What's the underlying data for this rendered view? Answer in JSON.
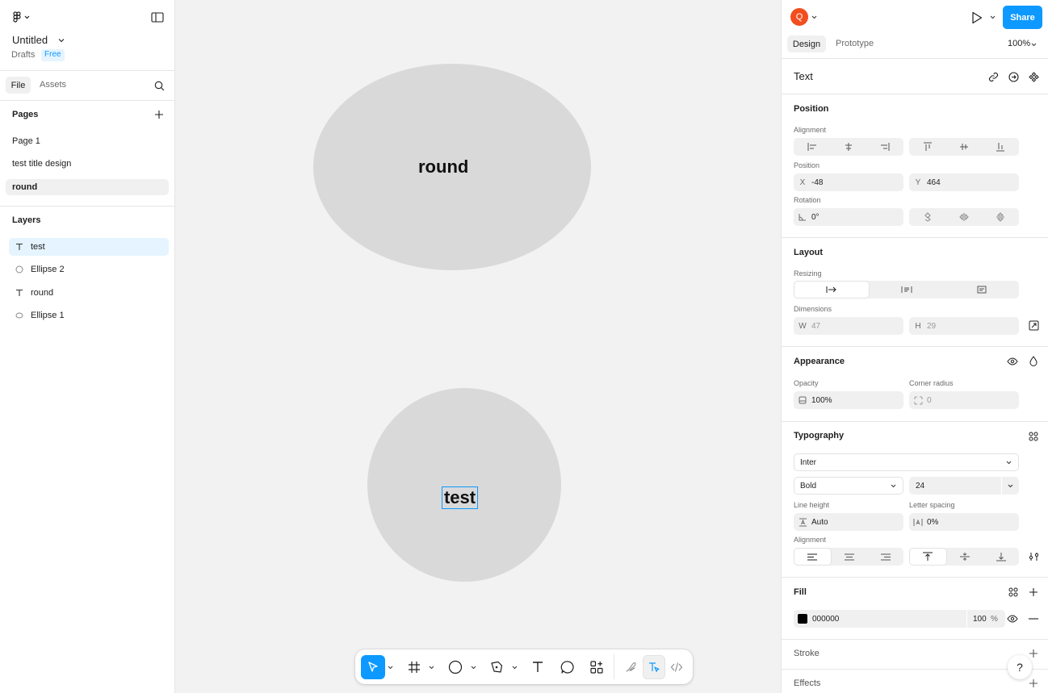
{
  "file": {
    "title": "Untitled",
    "location": "Drafts",
    "plan_badge": "Free"
  },
  "left_tabs": {
    "file": "File",
    "assets": "Assets"
  },
  "pages": {
    "heading": "Pages",
    "items": [
      "Page 1",
      "test  title design",
      "round"
    ],
    "selected": "round"
  },
  "layers": {
    "heading": "Layers",
    "items": [
      {
        "name": "test",
        "icon": "text-icon",
        "selected": true
      },
      {
        "name": "Ellipse 2",
        "icon": "ellipse-icon",
        "selected": false
      },
      {
        "name": "round",
        "icon": "text-icon",
        "selected": false
      },
      {
        "name": "Ellipse 1",
        "icon": "ellipse-icon",
        "selected": false
      }
    ]
  },
  "canvas": {
    "text_round": "round",
    "text_test": "test"
  },
  "header": {
    "avatar_letter": "Q",
    "share": "Share",
    "zoom": "100%",
    "tab_design": "Design",
    "tab_prototype": "Prototype"
  },
  "selection": {
    "type": "Text"
  },
  "position": {
    "title": "Position",
    "alignment_label": "Alignment",
    "position_label": "Position",
    "x_label": "X",
    "x": "-48",
    "y_label": "Y",
    "y": "464",
    "rotation_label": "Rotation",
    "rotation": "0°"
  },
  "layout": {
    "title": "Layout",
    "resizing_label": "Resizing",
    "dimensions_label": "Dimensions",
    "w_label": "W",
    "w": "47",
    "h_label": "H",
    "h": "29"
  },
  "appearance": {
    "title": "Appearance",
    "opacity_label": "Opacity",
    "opacity": "100%",
    "radius_label": "Corner radius",
    "radius": "0"
  },
  "typography": {
    "title": "Typography",
    "font": "Inter",
    "weight": "Bold",
    "size": "24",
    "line_height_label": "Line height",
    "line_height": "Auto",
    "letter_spacing_label": "Letter spacing",
    "letter_spacing": "0%",
    "alignment_label": "Alignment"
  },
  "fill": {
    "title": "Fill",
    "hex": "000000",
    "opacity": "100",
    "percent": "%",
    "swatch_color": "#000000"
  },
  "stroke": {
    "title": "Stroke"
  },
  "effects": {
    "title": "Effects"
  },
  "help": "?",
  "colors": {
    "accent": "#0d99ff",
    "avatar": "#f24e1e",
    "selected_layer": "#e5f4ff",
    "canvas": "#f2f2f2",
    "shape": "#d9d9d9"
  }
}
